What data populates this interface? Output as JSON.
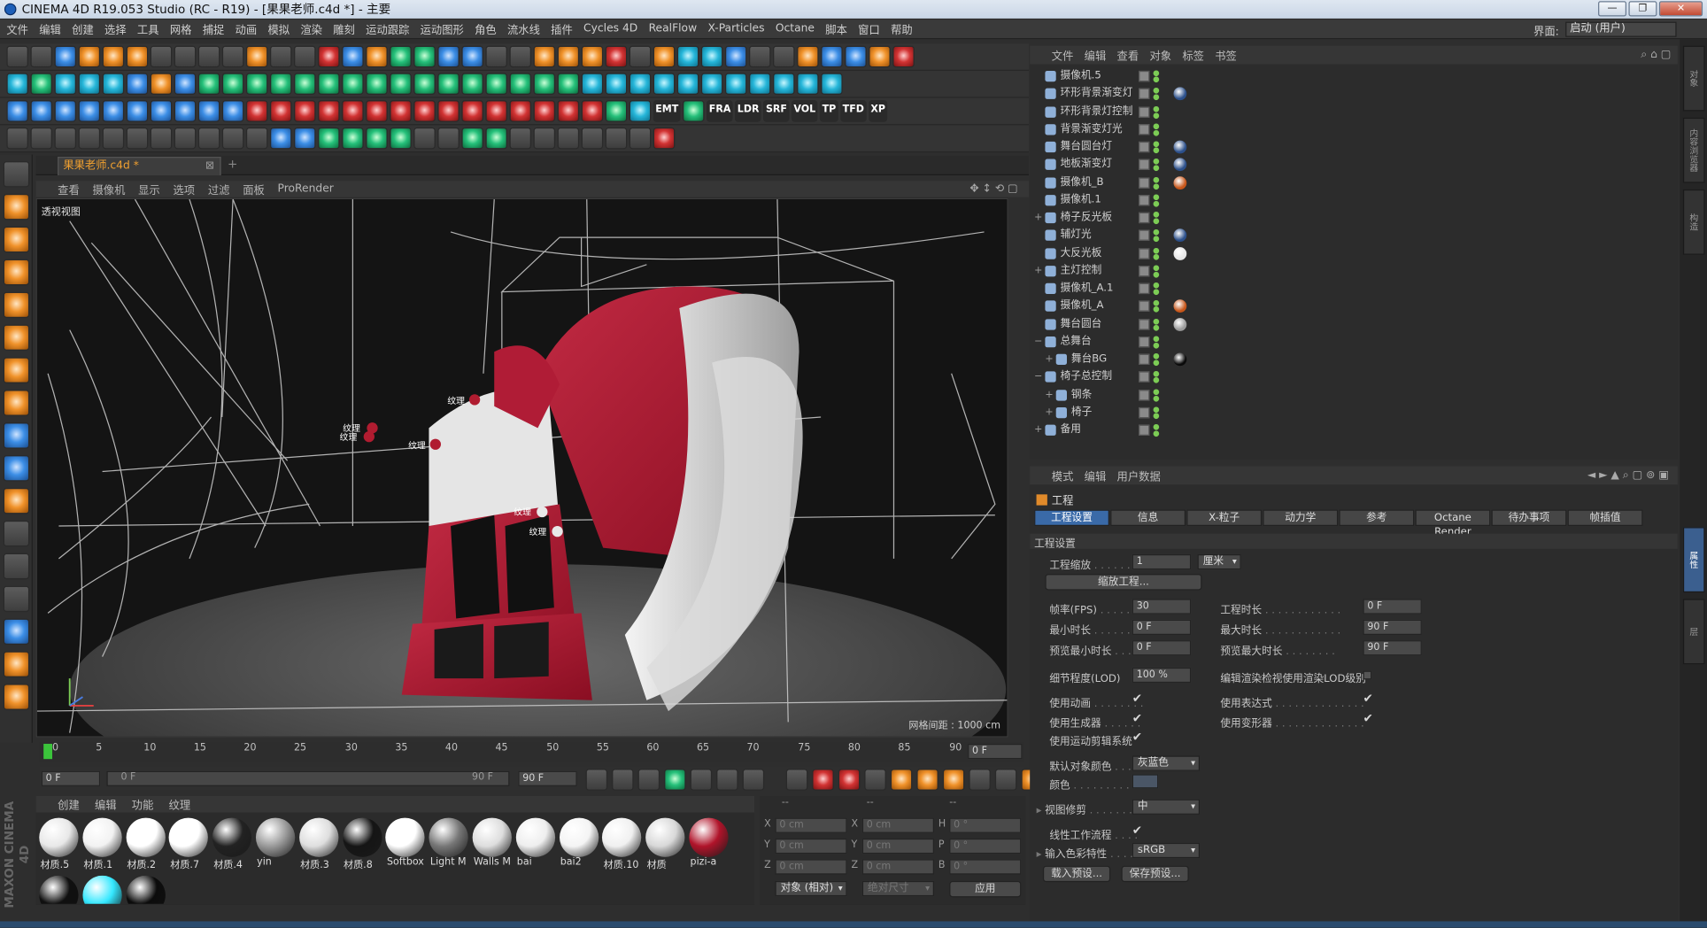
{
  "window": {
    "title": "CINEMA 4D R19.053 Studio (RC - R19) - [果果老师.c4d *] - 主要",
    "controls": [
      "—",
      "❐",
      "✕"
    ]
  },
  "menubar": {
    "items": [
      "文件",
      "编辑",
      "创建",
      "选择",
      "工具",
      "网格",
      "捕捉",
      "动画",
      "模拟",
      "渲染",
      "雕刻",
      "运动跟踪",
      "运动图形",
      "角色",
      "流水线",
      "插件",
      "Cycles 4D",
      "RealFlow",
      "X-Particles",
      "Octane",
      "脚本",
      "窗口",
      "帮助"
    ],
    "interface_label": "界面:",
    "interface_value": "启动 (用户)"
  },
  "toolbar": {
    "octane_labels": [
      "EMT",
      "LDR",
      "FRA",
      "SRF",
      "VOL",
      "TP",
      "TFD",
      "XP"
    ]
  },
  "document": {
    "tab": "果果老师.c4d *",
    "close": "⊠",
    "add": "+"
  },
  "viewport": {
    "menu": [
      "查看",
      "摄像机",
      "显示",
      "选项",
      "过滤",
      "面板",
      "ProRender"
    ],
    "label": "透视视图",
    "grid_info": "网格间距 : 1000 cm",
    "texture_tags": [
      "纹理",
      "纹理",
      "纹理",
      "纹理",
      "纹理",
      "纹理"
    ]
  },
  "timeline": {
    "ticks": [
      "0",
      "5",
      "10",
      "15",
      "20",
      "25",
      "30",
      "35",
      "40",
      "45",
      "50",
      "55",
      "60",
      "65",
      "70",
      "75",
      "80",
      "85",
      "90"
    ],
    "end_field": "0 F"
  },
  "transport": {
    "start": "0 F",
    "range_start": "0 F",
    "range_end": "90 F",
    "end": "90 F"
  },
  "materials": {
    "menu": [
      "创建",
      "编辑",
      "功能",
      "纹理"
    ],
    "items": [
      {
        "name": "材质.5",
        "color": "#e8e8e8"
      },
      {
        "name": "材质.1",
        "color": "#f2f2f2"
      },
      {
        "name": "材质.2",
        "color": "#ffffff"
      },
      {
        "name": "材质.7",
        "color": "#ffffff"
      },
      {
        "name": "材质.4",
        "color": "#222222"
      },
      {
        "name": "yin",
        "color": "#9a9a9a"
      },
      {
        "name": "材质.3",
        "color": "#dedede"
      },
      {
        "name": "材质.8",
        "color": "#151515"
      },
      {
        "name": "Softbox",
        "color": "#ffffff"
      },
      {
        "name": "Light M",
        "color": "#777777"
      },
      {
        "name": "Walls M",
        "color": "#dddddd"
      },
      {
        "name": "bai",
        "color": "#eeeeee"
      },
      {
        "name": "bai2",
        "color": "#f4f4f4"
      },
      {
        "name": "材质.10",
        "color": "#f0f0f0"
      },
      {
        "name": "材质",
        "color": "#d8d8d8"
      },
      {
        "name": "pizi-a",
        "color": "#b0142a"
      }
    ],
    "extra": [
      {
        "color": "#101010"
      },
      {
        "color": "#35e8ff"
      },
      {
        "color": "#0c0c0c"
      }
    ]
  },
  "coords": {
    "head": [
      "--",
      "--",
      "--"
    ],
    "rows": [
      {
        "axis": "X",
        "pos": "0 cm",
        "axis2": "X",
        "size": "0 cm",
        "axis3": "H",
        "rot": "0 °"
      },
      {
        "axis": "Y",
        "pos": "0 cm",
        "axis2": "Y",
        "size": "0 cm",
        "axis3": "P",
        "rot": "0 °"
      },
      {
        "axis": "Z",
        "pos": "0 cm",
        "axis2": "Z",
        "size": "0 cm",
        "axis3": "B",
        "rot": "0 °"
      }
    ],
    "mode": "对象 (相对)",
    "size_mode": "绝对尺寸",
    "apply": "应用"
  },
  "objects": {
    "menu": [
      "文件",
      "编辑",
      "查看",
      "对象",
      "标签",
      "书签"
    ],
    "rows": [
      {
        "name": "摄像机.5",
        "indent": 0,
        "expand": ""
      },
      {
        "name": "环形背景渐变灯",
        "indent": 0,
        "expand": "",
        "tag": "target"
      },
      {
        "name": "环形背景灯控制",
        "indent": 0,
        "expand": ""
      },
      {
        "name": "背景渐变灯光",
        "indent": 0,
        "expand": ""
      },
      {
        "name": "舞台圆台灯",
        "indent": 0,
        "expand": "",
        "tag": "target"
      },
      {
        "name": "地板渐变灯",
        "indent": 0,
        "expand": "",
        "tag": "target"
      },
      {
        "name": "摄像机_B",
        "indent": 0,
        "expand": "",
        "tag": "orange"
      },
      {
        "name": "摄像机.1",
        "indent": 0,
        "expand": ""
      },
      {
        "name": "椅子反光板",
        "indent": 0,
        "expand": "+"
      },
      {
        "name": "辅灯光",
        "indent": 0,
        "expand": "",
        "tag": "target"
      },
      {
        "name": "大反光板",
        "indent": 0,
        "expand": "",
        "tag": "white"
      },
      {
        "name": "主灯控制",
        "indent": 0,
        "expand": "+"
      },
      {
        "name": "摄像机_A.1",
        "indent": 0,
        "expand": ""
      },
      {
        "name": "摄像机_A",
        "indent": 0,
        "expand": "",
        "tag": "orange"
      },
      {
        "name": "舞台圆台",
        "indent": 0,
        "expand": "",
        "tag": "grey"
      },
      {
        "name": "总舞台",
        "indent": 0,
        "expand": "−"
      },
      {
        "name": "舞台BG",
        "indent": 1,
        "expand": "+",
        "tag": "black"
      },
      {
        "name": "椅子总控制",
        "indent": 0,
        "expand": "−"
      },
      {
        "name": "钢条",
        "indent": 1,
        "expand": "+"
      },
      {
        "name": "椅子",
        "indent": 1,
        "expand": "+"
      },
      {
        "name": "备用",
        "indent": 0,
        "expand": "+"
      }
    ]
  },
  "attributes": {
    "menu": [
      "模式",
      "编辑",
      "用户数据"
    ],
    "title": "工程",
    "tabs": [
      "工程设置",
      "信息",
      "X-粒子",
      "动力学",
      "参考",
      "Octane Render",
      "待办事项",
      "帧插值"
    ],
    "section": "工程设置",
    "scale_label": "工程缩放",
    "scale_value": "1",
    "scale_unit": "厘米",
    "scale_button": "缩放工程...",
    "fps_label": "帧率(FPS)",
    "fps_value": "30",
    "duration_label": "工程时长",
    "duration_value": "0 F",
    "min_label": "最小时长",
    "min_value": "0 F",
    "max_label": "最大时长",
    "max_value": "90 F",
    "pmin_label": "预览最小时长",
    "pmin_value": "0 F",
    "pmax_label": "预览最大时长",
    "pmax_value": "90 F",
    "lod_label": "细节程度(LOD)",
    "lod_value": "100 %",
    "lod_render_label": "编辑渲染检视使用渲染LOD级别",
    "anim_label": "使用动画",
    "expr_label": "使用表达式",
    "gen_label": "使用生成器",
    "deform_label": "使用变形器",
    "motion_label": "使用运动剪辑系统",
    "objcolor_label": "默认对象颜色",
    "objcolor_value": "灰蓝色",
    "color_label": "颜色",
    "clip_label": "视图修剪",
    "clip_value": "中",
    "linear_label": "线性工作流程",
    "cs_label": "输入色彩特性",
    "cs_value": "sRGB",
    "load_btn": "载入预设...",
    "save_btn": "保存预设...",
    "check": "✔"
  },
  "sidebar_tabs": [
    "对象",
    "内容浏览器",
    "构造",
    "属性",
    "层"
  ],
  "brand": "MAXON CINEMA 4D"
}
